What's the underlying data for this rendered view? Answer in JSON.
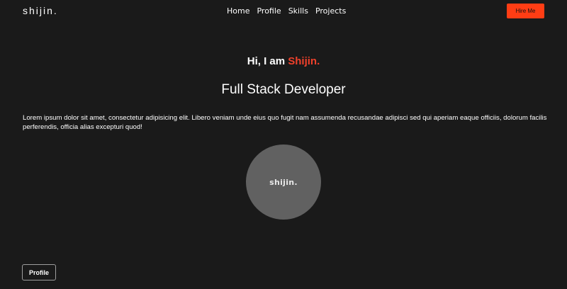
{
  "nav": {
    "logo": "shijin.",
    "links": [
      "Home",
      "Profile",
      "Skills",
      "Projects"
    ],
    "hire_label": "Hire Me"
  },
  "hero": {
    "greeting_prefix": "Hi, I am ",
    "greeting_name": "Shijin.",
    "role": "Full Stack Developer",
    "description": "Lorem ipsum dolor sit amet, consectetur adipisicing elit. Libero veniam unde eius quo fugit nam assumenda recusandae adipisci sed qui aperiam eaque officiis, dolorum facilis perferendis, officia alias excepturi quod!",
    "avatar_text": "shijin."
  },
  "footer": {
    "profile_label": "Profile"
  },
  "colors": {
    "background": "#1a1a1a",
    "accent": "#ff3d14",
    "name": "#f1412b",
    "avatar": "#616161"
  }
}
